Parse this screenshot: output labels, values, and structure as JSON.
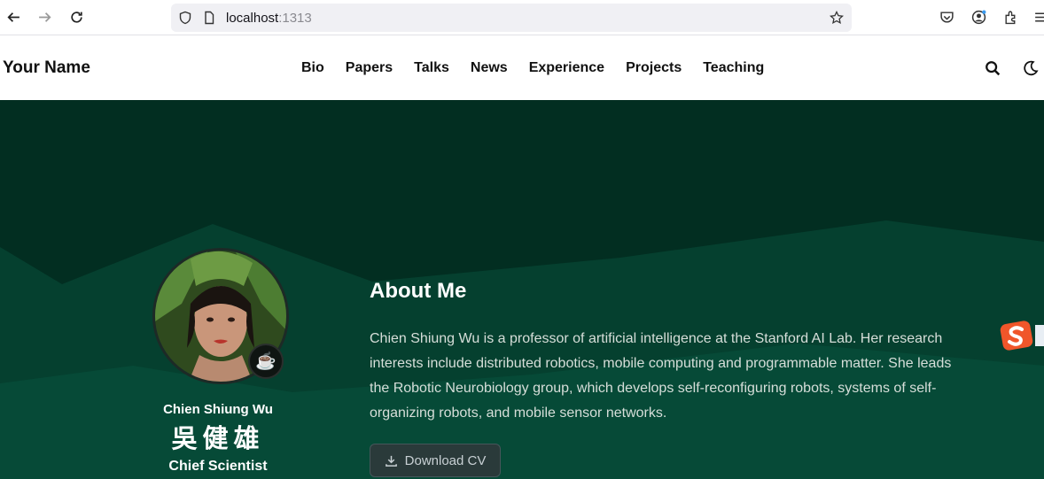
{
  "browser": {
    "url_host": "localhost",
    "url_port": ":1313",
    "icons": [
      "back-arrow-icon",
      "forward-arrow-icon",
      "reload-icon",
      "shield-icon",
      "page-icon",
      "bookmark-star-icon",
      "pocket-icon",
      "account-icon",
      "extensions-icon",
      "menu-icon"
    ]
  },
  "header": {
    "brand": "Your Name",
    "nav": [
      "Bio",
      "Papers",
      "Talks",
      "News",
      "Experience",
      "Projects",
      "Teaching"
    ],
    "icons": [
      "search-icon",
      "moon-icon"
    ]
  },
  "profile": {
    "name": "Chien Shiung Wu",
    "name_cjk": "吳健雄",
    "role": "Chief Scientist",
    "status_emoji": "☕"
  },
  "about": {
    "title": "About Me",
    "body": "Chien Shiung Wu is a professor of artificial intelligence at the Stanford AI Lab. Her research interests include distributed robotics, mobile computing and programmable matter. She leads the Robotic Neurobiology group, which develops self-reconfiguring robots, systems of self-organizing robots, and mobile sensor networks.",
    "cv_label": "Download CV"
  },
  "colors": {
    "hero_bg": "#022e21",
    "hero_wave": "#064a37",
    "button_bg": "#2a3a3a"
  }
}
